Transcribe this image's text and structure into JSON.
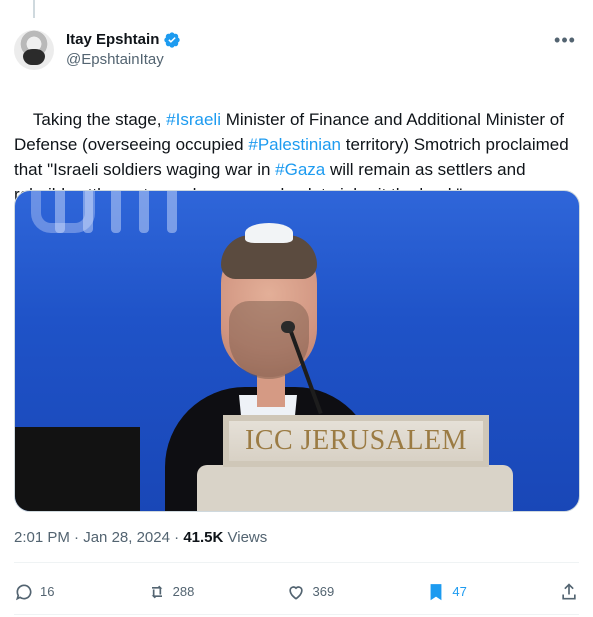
{
  "author": {
    "display_name": "Itay Epshtain",
    "handle": "@EpshtainItay",
    "verified_icon": "verified-badge-icon",
    "avatar_icon": "avatar-image"
  },
  "tweet": {
    "segments": [
      {
        "text": "Taking the stage, ",
        "type": "text"
      },
      {
        "text": "#Israeli",
        "type": "hashtag"
      },
      {
        "text": " Minister of Finance and Additional Minister of Defense (overseeing occupied ",
        "type": "text"
      },
      {
        "text": "#Palestinian",
        "type": "hashtag"
      },
      {
        "text": " territory) Smotrich proclaimed that \"Israeli soldiers waging war in ",
        "type": "text"
      },
      {
        "text": "#Gaza",
        "type": "hashtag"
      },
      {
        "text": " will remain as settlers and rebuild settlements, we have come back to inherit the land.\"",
        "type": "text"
      }
    ]
  },
  "media": {
    "sign_text": "ICC JERUSALEM"
  },
  "meta": {
    "time": "2:01 PM",
    "separator": "·",
    "date": "Jan 28, 2024",
    "views_count": "41.5K",
    "views_label": "Views"
  },
  "actions": {
    "reply_count": "16",
    "retweet_count": "288",
    "like_count": "369",
    "bookmark_count": "47"
  },
  "colors": {
    "link": "#1d9bf0",
    "text": "#0f1419",
    "secondary": "#536471"
  }
}
